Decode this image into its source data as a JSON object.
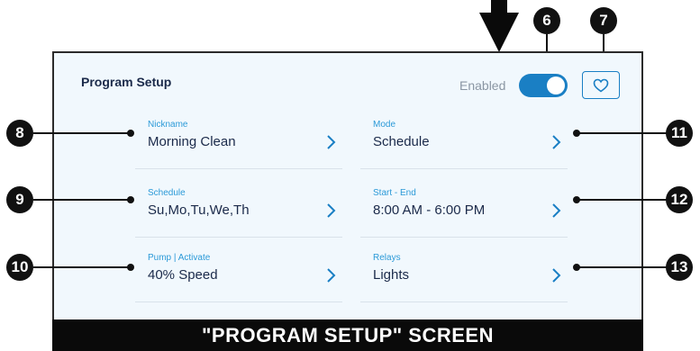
{
  "screen": {
    "title": "Program Setup",
    "enabled_label": "Enabled",
    "enabled_state": true,
    "accent_color": "#1a7fc4",
    "label_color": "#2c9ad8",
    "fields": [
      {
        "label": "Nickname",
        "value": "Morning Clean"
      },
      {
        "label": "Mode",
        "value": "Schedule"
      },
      {
        "label": "Schedule",
        "value": "Su,Mo,Tu,We,Th"
      },
      {
        "label": "Start - End",
        "value": "8:00 AM - 6:00 PM"
      },
      {
        "label": "Pump  |  Activate",
        "value": "40% Speed"
      },
      {
        "label": "Relays",
        "value": "Lights"
      }
    ]
  },
  "callouts": {
    "c6": "6",
    "c7": "7",
    "c8": "8",
    "c9": "9",
    "c10": "10",
    "c11": "11",
    "c12": "12",
    "c13": "13"
  },
  "caption": "\"PROGRAM SETUP\" SCREEN",
  "icons": {
    "chevron": "chevron-right-icon",
    "favorite": "heart-icon",
    "pointer": "down-arrow-icon"
  }
}
